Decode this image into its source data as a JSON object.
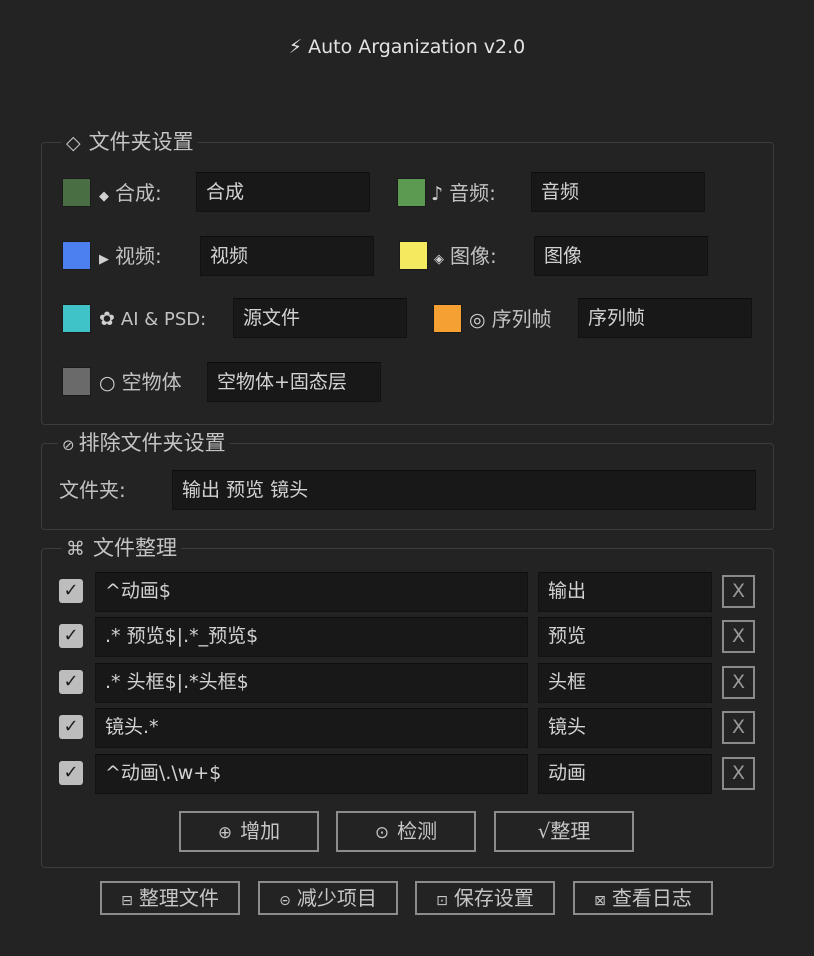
{
  "app": {
    "title": "⚡ Auto Arganization v2.0"
  },
  "folder_settings": {
    "legend_icon": "◇",
    "legend": "文件夹设置",
    "items": [
      {
        "icon": "◆",
        "label": "合成:",
        "value": "合成",
        "color": "#4a6e44"
      },
      {
        "icon": "♪",
        "label": "音频:",
        "value": "音频",
        "color": "#5c9a52"
      },
      {
        "icon": "▶",
        "label": "视频:",
        "value": "视频",
        "color": "#4c80f0"
      },
      {
        "icon": "◈",
        "label": "图像:",
        "value": "图像",
        "color": "#f5ea5f"
      },
      {
        "icon": "✿",
        "label": "AI & PSD:",
        "value": "源文件",
        "color": "#3fc3c8"
      },
      {
        "icon": "◎",
        "label": "序列帧",
        "value": "序列帧",
        "color": "#f5a033"
      },
      {
        "icon": "○",
        "label": "空物体",
        "value": "空物体+固态层",
        "color": "#6a6a6a"
      }
    ]
  },
  "exclude_settings": {
    "legend_icon": "⊘",
    "legend": "排除文件夹设置",
    "folder_label": "文件夹:",
    "folder_value": "输出 预览 镜头"
  },
  "organize": {
    "legend_icon": "⌘",
    "legend": "文件整理",
    "check_glyph": "✓",
    "remove_label": "X",
    "rules": [
      {
        "pattern": "^动画$",
        "target": "输出",
        "checked": true
      },
      {
        "pattern": ".* 预览$|.*_预览$",
        "target": "预览",
        "checked": true
      },
      {
        "pattern": ".* 头框$|.*头框$",
        "target": "头框",
        "checked": true
      },
      {
        "pattern": "镜头.*",
        "target": "镜头",
        "checked": true
      },
      {
        "pattern": "^动画\\.\\w+$",
        "target": "动画",
        "checked": true
      }
    ],
    "buttons": {
      "add_icon": "⊕",
      "add": "增加",
      "detect_icon": "⊙",
      "detect": "检测",
      "sort": "√整理"
    }
  },
  "footer": {
    "organize_files_icon": "⊟",
    "organize_files": "整理文件",
    "reduce_items_icon": "⊝",
    "reduce_items": "减少项目",
    "save_settings_icon": "⊡",
    "save_settings": "保存设置",
    "view_log_icon": "⊠",
    "view_log": "查看日志"
  }
}
